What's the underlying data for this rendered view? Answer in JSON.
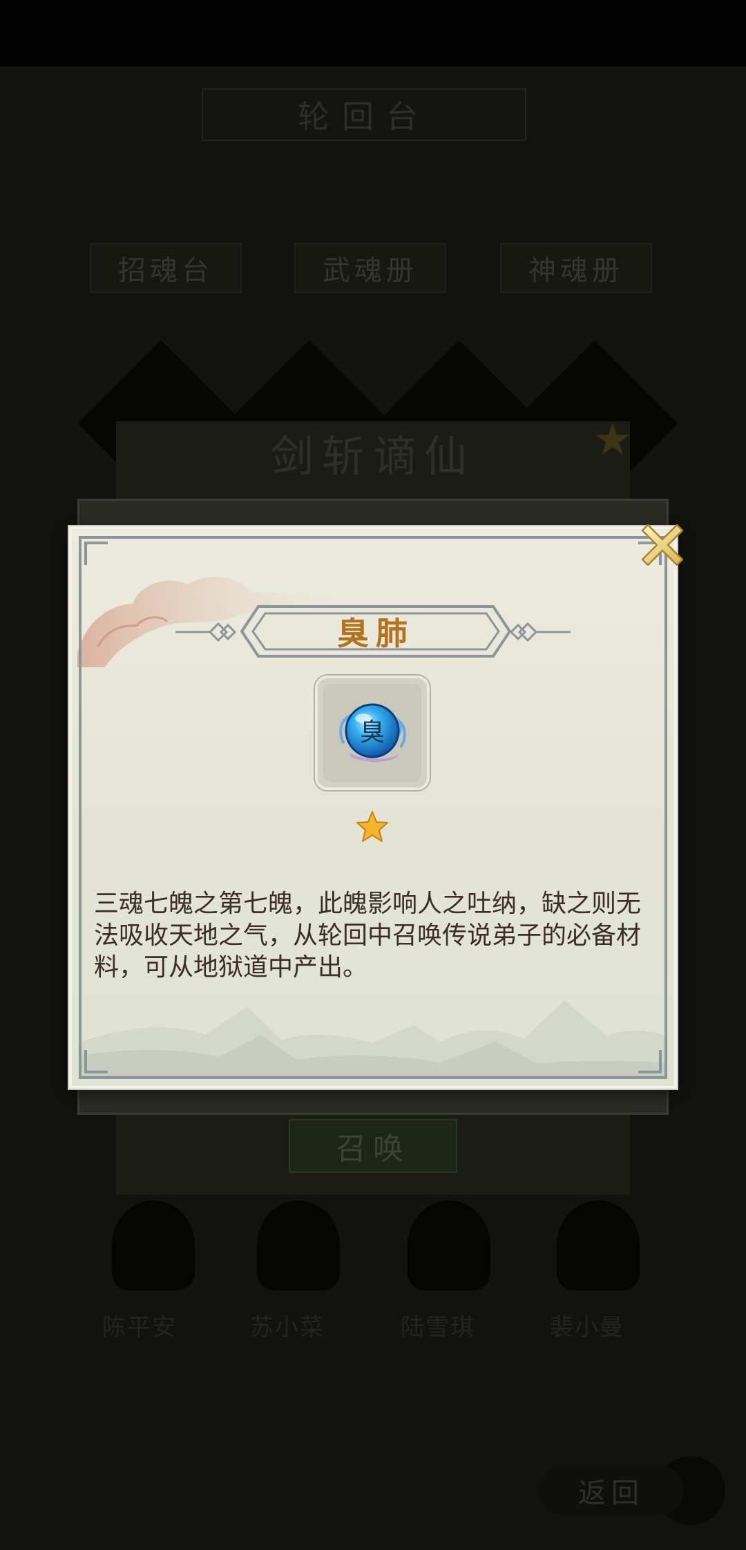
{
  "background": {
    "title": "轮回台",
    "tabs": [
      "招魂台",
      "武魂册",
      "神魂册"
    ],
    "summon_title": "剑斩谪仙",
    "summon_button": "召唤",
    "disciple_names": [
      "陈平安",
      "苏小菜",
      "陆雪琪",
      "裴小曼"
    ],
    "back_button": "返回"
  },
  "dialog": {
    "item_name": "臭肺",
    "item_icon": "blue-soul-orb-icon",
    "icon_glyph": "臭",
    "stars": 1,
    "description": "三魂七魄之第七魄，此魄影响人之吐纳，缺之则无法吸收天地之气，从轮回中召唤传说弟子的必备材料，可从地狱道中产出。"
  },
  "colors": {
    "item_name": "#b2731f",
    "dialog_bg": "#e8e7d8",
    "dialog_border": "#8a9698",
    "description_text": "#3c2e22"
  }
}
